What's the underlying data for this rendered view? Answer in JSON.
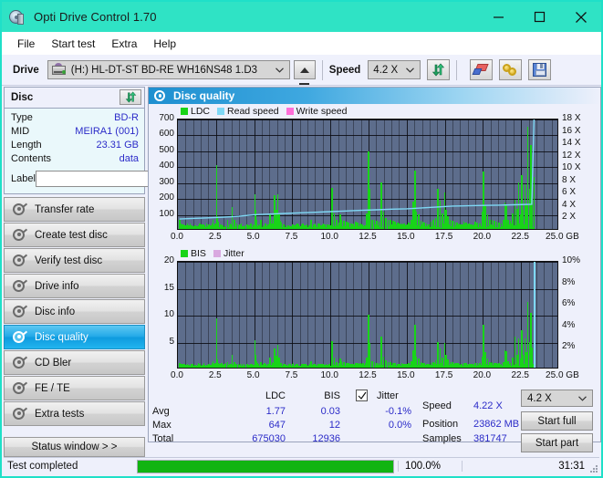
{
  "window": {
    "title": "Opti Drive Control 1.70",
    "icon": "disc-drive-icon",
    "minimize": "─",
    "maximize": "□",
    "close": "✕"
  },
  "menu": {
    "items": [
      "File",
      "Start test",
      "Extra",
      "Help"
    ]
  },
  "toolbar": {
    "drive_label": "Drive",
    "drive_value": "(H:)  HL-DT-ST BD-RE  WH16NS48 1.D3",
    "eject_label": "eject-button",
    "speed_label": "Speed",
    "speed_value": "4.2 X",
    "refresh_label": "refresh-button",
    "erase_label": "erase-button",
    "bookmark_label": "bookmark-button",
    "save_label": "save-button"
  },
  "disc": {
    "header": "Disc",
    "refresh_icon": "refresh-icon",
    "rows": [
      {
        "label": "Type",
        "value": "BD-R"
      },
      {
        "label": "MID",
        "value": "MEIRA1 (001)"
      },
      {
        "label": "Length",
        "value": "23.31 GB"
      },
      {
        "label": "Contents",
        "value": "data"
      }
    ],
    "label_field_label": "Label",
    "label_field_value": "",
    "label_field_placeholder": "",
    "disc_icon": "cd-icon"
  },
  "nav": {
    "items": [
      {
        "label": "Transfer rate",
        "active": false
      },
      {
        "label": "Create test disc",
        "active": false
      },
      {
        "label": "Verify test disc",
        "active": false
      },
      {
        "label": "Drive info",
        "active": false
      },
      {
        "label": "Disc info",
        "active": false
      },
      {
        "label": "Disc quality",
        "active": true
      },
      {
        "label": "CD Bler",
        "active": false
      },
      {
        "label": "FE / TE",
        "active": false
      },
      {
        "label": "Extra tests",
        "active": false
      }
    ],
    "status_window": "Status window > >"
  },
  "panel": {
    "title": "Disc quality",
    "icon": "disc-quality-icon"
  },
  "stats": {
    "columns": [
      "LDC",
      "BIS"
    ],
    "jitter_label": "Jitter",
    "jitter_checked": true,
    "rows": [
      {
        "label": "Avg",
        "ldc": "1.77",
        "bis": "0.03",
        "jitter": "-0.1%"
      },
      {
        "label": "Max",
        "ldc": "647",
        "bis": "12",
        "jitter": "0.0%"
      },
      {
        "label": "Total",
        "ldc": "675030",
        "bis": "12936",
        "jitter": ""
      }
    ],
    "speed_label": "Speed",
    "speed_value": "4.22 X",
    "position_label": "Position",
    "position_value": "23862 MB",
    "samples_label": "Samples",
    "samples_value": "381747",
    "speed_select": "4.2 X",
    "start_full": "Start full",
    "start_part": "Start part"
  },
  "statusbar": {
    "message": "Test completed",
    "percent_text": "100.0%",
    "percent_value": 100,
    "time": "31:31"
  },
  "colors": {
    "accent": "#2fe3c5",
    "ldc_green": "#18d418",
    "read_speed": "#7fd8f5",
    "write_speed": "#ff6fd8",
    "jitter": "#d9a8e0",
    "plot_bg": "#5d6d8c",
    "value_blue": "#2b2bc8",
    "progress_green": "#11b411",
    "selected_nav": "#23a9e8"
  },
  "chart_data": [
    {
      "type": "bar",
      "name": "ldc-chart",
      "title": "",
      "xlabel": "GB",
      "ylabel": "LDC",
      "legend": [
        {
          "label": "LDC",
          "color": "#18d418"
        },
        {
          "label": "Read speed",
          "color": "#7fd8f5"
        },
        {
          "label": "Write speed",
          "color": "#ff6fd8"
        }
      ],
      "legend_position": "top-left",
      "grid": true,
      "xlim": [
        0,
        25
      ],
      "xticks": [
        "0.0",
        "2.5",
        "5.0",
        "7.5",
        "10.0",
        "12.5",
        "15.0",
        "17.5",
        "20.0",
        "22.5",
        "25.0 GB"
      ],
      "ylim": [
        0,
        700
      ],
      "yticks": [
        "100",
        "200",
        "300",
        "400",
        "500",
        "600",
        "700"
      ],
      "y2lim": [
        0,
        18
      ],
      "y2ticks": [
        "2 X",
        "4 X",
        "6 X",
        "8 X",
        "10 X",
        "12 X",
        "14 X",
        "16 X",
        "18 X"
      ],
      "x": [
        0.08,
        0.2,
        0.32,
        0.45,
        0.58,
        0.7,
        0.85,
        0.98,
        1.1,
        1.25,
        1.4,
        1.55,
        1.7,
        1.85,
        2.0,
        2.12,
        2.25,
        2.4,
        2.5,
        2.55,
        2.62,
        2.75,
        2.9,
        3.05,
        3.2,
        3.35,
        3.5,
        3.65,
        3.8,
        3.95,
        4.05,
        4.2,
        4.35,
        4.5,
        4.62,
        4.75,
        4.9,
        5.0,
        5.05,
        5.12,
        5.25,
        5.4,
        5.55,
        5.7,
        5.85,
        6.0,
        6.15,
        6.3,
        6.4,
        6.5,
        6.6,
        6.65,
        6.75,
        6.9,
        7.05,
        7.2,
        7.35,
        7.5,
        7.65,
        7.8,
        7.95,
        8.1,
        8.25,
        8.4,
        8.55,
        8.7,
        8.85,
        9.0,
        9.15,
        9.3,
        9.45,
        9.6,
        9.75,
        9.9,
        10.05,
        10.2,
        10.35,
        10.5,
        10.6,
        10.7,
        10.85,
        11.0,
        11.15,
        11.3,
        11.45,
        11.6,
        11.75,
        11.9,
        12.05,
        12.2,
        12.35,
        12.45,
        12.5,
        12.55,
        12.7,
        12.85,
        13.0,
        13.15,
        13.3,
        13.45,
        13.6,
        13.75,
        13.9,
        14.05,
        14.2,
        14.35,
        14.5,
        14.65,
        14.8,
        14.95,
        15.1,
        15.25,
        15.4,
        15.5,
        15.6,
        15.75,
        15.9,
        16.0,
        16.1,
        16.25,
        16.4,
        16.55,
        16.7,
        16.85,
        17.0,
        17.15,
        17.3,
        17.45,
        17.55,
        17.65,
        17.8,
        17.95,
        18.1,
        18.25,
        18.4,
        18.55,
        18.7,
        18.85,
        19.0,
        19.15,
        19.3,
        19.45,
        19.6,
        19.75,
        19.9,
        20.0,
        20.1,
        20.25,
        20.4,
        20.55,
        20.7,
        20.85,
        21.0,
        21.15,
        21.3,
        21.4,
        21.5,
        21.6,
        21.75,
        21.9,
        22.05,
        22.2,
        22.3,
        22.4,
        22.5,
        22.6,
        22.7,
        22.8,
        22.9,
        23.0,
        23.1,
        23.2,
        23.3
      ],
      "values": [
        55,
        28,
        22,
        18,
        30,
        20,
        25,
        18,
        22,
        20,
        28,
        18,
        25,
        20,
        30,
        22,
        60,
        35,
        403,
        80,
        45,
        30,
        25,
        20,
        55,
        30,
        140,
        60,
        35,
        25,
        30,
        20,
        25,
        30,
        22,
        35,
        25,
        218,
        120,
        60,
        30,
        55,
        25,
        35,
        30,
        100,
        60,
        210,
        120,
        218,
        95,
        50,
        40,
        30,
        25,
        22,
        20,
        30,
        25,
        22,
        18,
        30,
        25,
        20,
        22,
        60,
        30,
        25,
        20,
        22,
        30,
        25,
        22,
        30,
        260,
        95,
        55,
        40,
        90,
        60,
        50,
        45,
        40,
        35,
        30,
        45,
        40,
        35,
        30,
        25,
        100,
        490,
        250,
        110,
        60,
        55,
        50,
        45,
        290,
        110,
        70,
        60,
        55,
        50,
        45,
        40,
        35,
        30,
        35,
        30,
        40,
        60,
        170,
        365,
        110,
        90,
        50,
        45,
        40,
        35,
        30,
        45,
        55,
        70,
        250,
        180,
        95,
        230,
        120,
        80,
        60,
        50,
        45,
        40,
        35,
        30,
        45,
        40,
        35,
        30,
        25,
        45,
        40,
        35,
        110,
        360,
        150,
        90,
        60,
        55,
        50,
        45,
        40,
        35,
        55,
        165,
        155,
        60,
        50,
        95,
        185,
        125,
        290,
        90,
        340,
        120,
        280,
        150,
        645,
        250,
        530,
        200,
        330,
        80
      ],
      "speed_series": {
        "name": "Read speed",
        "color": "#7fd8f5",
        "x": [
          0.1,
          1.0,
          2.0,
          3.0,
          4.0,
          5.0,
          6.0,
          7.0,
          8.0,
          9.0,
          10.0,
          11.0,
          12.0,
          13.0,
          14.0,
          15.0,
          16.0,
          17.0,
          18.0,
          19.0,
          20.0,
          21.0,
          22.0,
          23.2,
          23.35
        ],
        "values_x": [
          1.9,
          2.0,
          2.1,
          2.2,
          2.35,
          2.6,
          2.7,
          2.8,
          2.9,
          3.0,
          3.1,
          3.2,
          3.3,
          3.4,
          3.5,
          3.55,
          3.7,
          3.85,
          4.0,
          4.05,
          4.1,
          4.15,
          4.2,
          4.3,
          18.0
        ]
      }
    },
    {
      "type": "bar",
      "name": "bis-chart",
      "title": "",
      "xlabel": "GB",
      "ylabel": "BIS",
      "legend": [
        {
          "label": "BIS",
          "color": "#18d418"
        },
        {
          "label": "Jitter",
          "color": "#d9a8e0"
        }
      ],
      "legend_position": "top-left",
      "grid": true,
      "xlim": [
        0,
        25
      ],
      "xticks": [
        "0.0",
        "2.5",
        "5.0",
        "7.5",
        "10.0",
        "12.5",
        "15.0",
        "17.5",
        "20.0",
        "22.5",
        "25.0 GB"
      ],
      "ylim": [
        0,
        20
      ],
      "yticks": [
        "5",
        "10",
        "15",
        "20"
      ],
      "y2lim": [
        0,
        10
      ],
      "y2ticks": [
        "2%",
        "4%",
        "6%",
        "8%",
        "10%"
      ],
      "x": [
        0.08,
        0.2,
        0.32,
        0.45,
        0.58,
        0.7,
        0.85,
        0.98,
        1.1,
        1.25,
        1.4,
        1.55,
        1.7,
        1.85,
        2.0,
        2.12,
        2.25,
        2.4,
        2.5,
        2.55,
        2.62,
        2.75,
        2.9,
        3.05,
        3.2,
        3.35,
        3.5,
        3.65,
        3.8,
        3.95,
        4.05,
        4.2,
        4.35,
        4.5,
        4.62,
        4.75,
        4.9,
        5.0,
        5.05,
        5.12,
        5.25,
        5.4,
        5.55,
        5.7,
        5.85,
        6.0,
        6.15,
        6.3,
        6.4,
        6.5,
        6.6,
        6.65,
        6.75,
        6.9,
        7.05,
        7.2,
        7.35,
        7.5,
        7.65,
        7.8,
        7.95,
        8.1,
        8.25,
        8.4,
        8.55,
        8.7,
        8.85,
        9.0,
        9.15,
        9.3,
        9.45,
        9.6,
        9.75,
        9.9,
        10.05,
        10.2,
        10.35,
        10.5,
        10.6,
        10.7,
        10.85,
        11.0,
        11.15,
        11.3,
        11.45,
        11.6,
        11.75,
        11.9,
        12.05,
        12.2,
        12.35,
        12.45,
        12.5,
        12.55,
        12.7,
        12.85,
        13.0,
        13.15,
        13.3,
        13.45,
        13.6,
        13.75,
        13.9,
        14.05,
        14.2,
        14.35,
        14.5,
        14.65,
        14.8,
        14.95,
        15.1,
        15.25,
        15.4,
        15.5,
        15.6,
        15.75,
        15.9,
        16.0,
        16.1,
        16.25,
        16.4,
        16.55,
        16.7,
        16.85,
        17.0,
        17.15,
        17.3,
        17.45,
        17.55,
        17.65,
        17.8,
        17.95,
        18.1,
        18.25,
        18.4,
        18.55,
        18.7,
        18.85,
        19.0,
        19.15,
        19.3,
        19.45,
        19.6,
        19.75,
        19.9,
        20.0,
        20.1,
        20.25,
        20.4,
        20.55,
        20.7,
        20.85,
        21.0,
        21.15,
        21.3,
        21.4,
        21.5,
        21.6,
        21.75,
        21.9,
        22.05,
        22.2,
        22.3,
        22.4,
        22.5,
        22.6,
        22.7,
        22.8,
        22.9,
        23.0,
        23.1,
        23.2,
        23.3
      ],
      "values": [
        0.8,
        0.6,
        0.5,
        0.4,
        0.7,
        0.5,
        0.6,
        0.4,
        0.5,
        0.5,
        0.6,
        0.4,
        0.5,
        0.5,
        0.7,
        0.5,
        1.2,
        0.8,
        9.2,
        1.5,
        0.9,
        0.6,
        0.5,
        0.4,
        1.0,
        0.6,
        2.4,
        1.1,
        0.7,
        0.5,
        0.6,
        0.4,
        0.5,
        0.6,
        0.5,
        0.7,
        0.5,
        5.1,
        2.4,
        1.2,
        0.6,
        1.0,
        0.5,
        0.7,
        0.6,
        1.8,
        1.1,
        3.6,
        2.2,
        4.2,
        1.8,
        0.9,
        0.8,
        0.6,
        0.5,
        0.4,
        0.4,
        0.6,
        0.5,
        0.4,
        0.4,
        0.6,
        0.5,
        0.4,
        0.5,
        1.2,
        0.6,
        0.5,
        0.4,
        0.4,
        0.6,
        0.5,
        0.4,
        0.6,
        5.0,
        1.8,
        1.1,
        0.8,
        1.7,
        1.2,
        1.0,
        0.9,
        0.8,
        0.7,
        0.6,
        0.9,
        0.8,
        0.7,
        0.6,
        0.5,
        1.9,
        9.8,
        4.6,
        2.1,
        1.2,
        1.0,
        0.9,
        0.8,
        5.8,
        2.1,
        1.3,
        1.1,
        1.0,
        0.9,
        0.8,
        0.7,
        0.6,
        0.6,
        0.7,
        0.6,
        0.8,
        1.2,
        3.2,
        8.0,
        2.1,
        1.7,
        1.0,
        0.9,
        0.8,
        0.7,
        0.6,
        0.9,
        1.1,
        1.4,
        4.8,
        3.5,
        1.8,
        4.5,
        2.3,
        1.5,
        1.1,
        1.0,
        0.9,
        0.8,
        0.7,
        0.6,
        0.9,
        0.8,
        0.7,
        0.6,
        0.5,
        0.9,
        0.8,
        0.7,
        2.1,
        8.0,
        2.9,
        1.7,
        1.1,
        1.0,
        0.9,
        0.8,
        0.8,
        0.7,
        1.0,
        3.2,
        3.0,
        1.2,
        0.9,
        1.8,
        5.7,
        2.4,
        5.5,
        1.7,
        6.9,
        2.3,
        5.4,
        2.9,
        12.2,
        4.8,
        10.2,
        3.8,
        6.3,
        1.5
      ]
    }
  ]
}
